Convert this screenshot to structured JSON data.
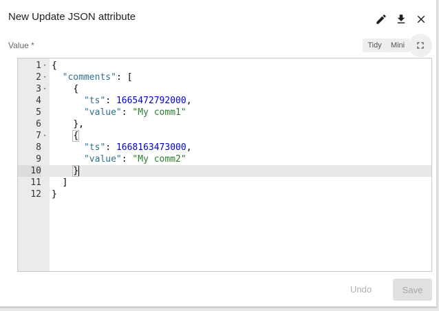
{
  "dialog": {
    "title": "New Update JSON attribute",
    "value_label": "Value *",
    "icons": [
      "pencil-icon",
      "download-icon",
      "close-icon"
    ]
  },
  "toolbar": {
    "tidy_label": "Tidy",
    "mini_label": "Mini",
    "fullscreen_icon": "fullscreen-icon"
  },
  "editor": {
    "active_line": 10,
    "lines": [
      {
        "num": "1",
        "fold": true
      },
      {
        "num": "2",
        "fold": true
      },
      {
        "num": "3",
        "fold": true
      },
      {
        "num": "4",
        "fold": false
      },
      {
        "num": "5",
        "fold": false
      },
      {
        "num": "6",
        "fold": false
      },
      {
        "num": "7",
        "fold": true
      },
      {
        "num": "8",
        "fold": false
      },
      {
        "num": "9",
        "fold": false
      },
      {
        "num": "10",
        "fold": false
      },
      {
        "num": "11",
        "fold": false
      },
      {
        "num": "12",
        "fold": false
      }
    ],
    "tokens": {
      "key_comments": "\"comments\"",
      "key_ts": "\"ts\"",
      "key_value": "\"value\"",
      "ts1": "1665472792000",
      "val1": "\"My comm1\"",
      "ts2": "1668163473000",
      "val2": "\"My comm2\""
    }
  },
  "footer": {
    "undo_label": "Undo",
    "save_label": "Save"
  },
  "colors": {
    "key": "#31708f",
    "number": "#0000cd",
    "string": "#2e7d32"
  }
}
